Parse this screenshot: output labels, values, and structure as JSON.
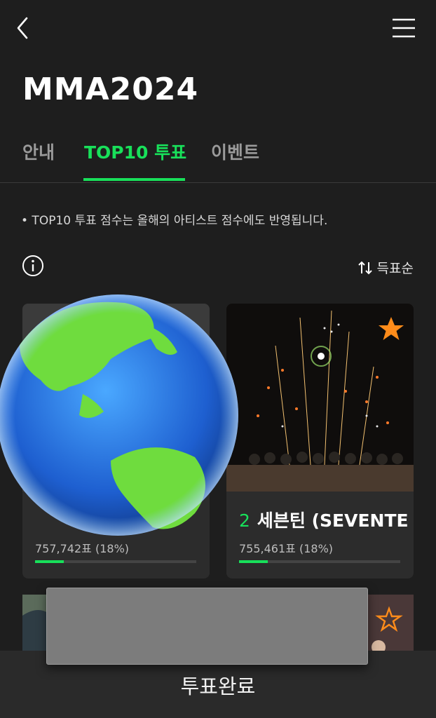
{
  "header": {
    "title": "MMA2024"
  },
  "tabs": [
    {
      "label": "안내"
    },
    {
      "label": "TOP10 투표"
    },
    {
      "label": "이벤트"
    }
  ],
  "notice": "• TOP10 투표 점수는 올해의 아티스트 점수에도 반영됩니다.",
  "sort": {
    "label": "득표순"
  },
  "cards": [
    {
      "votes": "757,742표 (18%)",
      "percent": 18,
      "star_filled": false
    },
    {
      "rank": "2",
      "name": "세븐틴 (SEVENTEEN)",
      "votes": "755,461표 (18%)",
      "percent": 18,
      "star_filled": true
    }
  ],
  "footer": {
    "complete_label": "투표완료"
  },
  "colors": {
    "accent": "#18e05a",
    "star": "#ff8c1a",
    "background": "#1e1e1e"
  },
  "icons": [
    "back-arrow-icon",
    "hamburger-menu-icon",
    "info-icon",
    "sort-arrows-icon",
    "star-icon",
    "globe-icon"
  ]
}
